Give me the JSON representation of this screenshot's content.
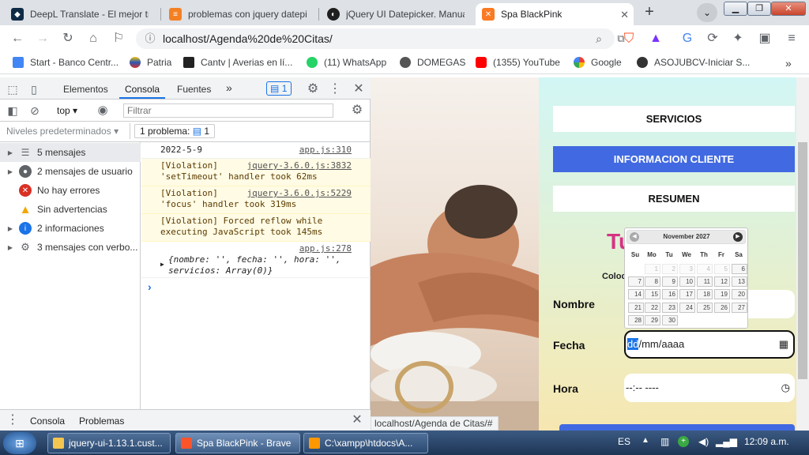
{
  "browser": {
    "tabs": [
      {
        "title": "DeepL Translate - El mejor trad",
        "icon": "deepl-icon"
      },
      {
        "title": "problemas con jquery datepick",
        "icon": "stackoverflow-icon"
      },
      {
        "title": "jQuery UI Datepicker. Manual d",
        "icon": "jquery-icon"
      },
      {
        "title": "Spa BlackPink",
        "icon": "xampp-icon"
      }
    ],
    "url": "localhost/Agenda%20de%20Citas/",
    "bookmarks": [
      "Start - Banco Centr...",
      "Patria",
      "Cantv | Averias en lí...",
      "(11) WhatsApp",
      "DOMEGAS",
      "(1355) YouTube",
      "Google",
      "ASOJUBCV-Iniciar S..."
    ],
    "bookmarks_more": "»"
  },
  "devtools": {
    "tabs": [
      "Elementos",
      "Consola",
      "Fuentes"
    ],
    "more_tabs": "»",
    "issues_badge": "1",
    "context": "top",
    "filter_placeholder": "Filtrar",
    "levels": "Niveles predeterminados",
    "problems": "1 problema:",
    "problems_count": "1",
    "sidebar": [
      {
        "label": "5 mensajes",
        "icon": "list-icon"
      },
      {
        "label": "2 mensajes de usuario",
        "icon": "user-icon"
      },
      {
        "label": "No hay errores",
        "icon": "error-icon"
      },
      {
        "label": "Sin advertencias",
        "icon": "warning-icon"
      },
      {
        "label": "2 informaciones",
        "icon": "info-icon"
      },
      {
        "label": "3 mensajes con verbo...",
        "icon": "gear-icon"
      }
    ],
    "log": [
      {
        "text": "2022-5-9",
        "link": "app.js:310",
        "type": "log"
      },
      {
        "text": "[Violation] 'setTimeout' handler took 62ms",
        "link": "jquery-3.6.0.js:3832",
        "type": "warn"
      },
      {
        "text": "[Violation] 'focus' handler took 319ms",
        "link": "jquery-3.6.0.js:5229",
        "type": "warn"
      },
      {
        "text": "[Violation] Forced reflow while executing JavaScript took 145ms",
        "link": "",
        "type": "warn"
      },
      {
        "text": "{nombre: '', fecha: '', hora: '', servicios: Array(0)}",
        "link": "app.js:278",
        "type": "log"
      }
    ],
    "prompt": "›",
    "drawer_tabs": [
      "Consola",
      "Problemas"
    ]
  },
  "page": {
    "nav": [
      "SERVICIOS",
      "INFORMACION CLIENTE",
      "RESUMEN"
    ],
    "heading_partial": "Tu",
    "subtext_partial": "Coloc",
    "fields": {
      "nombre_label": "Nombre",
      "fecha_label": "Fecha",
      "fecha_value_highlight": "dd",
      "fecha_value_rest": "/mm/aaaa",
      "hora_label": "Hora",
      "hora_value": "--:-- ----"
    },
    "datepicker": {
      "month": "November 2027",
      "weekdays": [
        "Su",
        "Mo",
        "Tu",
        "We",
        "Th",
        "Fr",
        "Sa"
      ],
      "weeks": [
        [
          "",
          "1",
          "2",
          "3",
          "4",
          "5",
          "6"
        ],
        [
          "7",
          "8",
          "9",
          "10",
          "11",
          "12",
          "13"
        ],
        [
          "14",
          "15",
          "16",
          "17",
          "18",
          "19",
          "20"
        ],
        [
          "21",
          "22",
          "23",
          "24",
          "25",
          "26",
          "27"
        ],
        [
          "28",
          "29",
          "30",
          "",
          "",
          "",
          ""
        ]
      ],
      "disabled_days": [
        "1",
        "2",
        "3",
        "4",
        "5"
      ]
    },
    "status_url": "localhost/Agenda de Citas/#"
  },
  "taskbar": {
    "items": [
      "jquery-ui-1.13.1.cust...",
      "Spa BlackPink - Brave",
      "C:\\xampp\\htdocs\\A..."
    ],
    "lang": "ES",
    "clock": "12:09 a.m."
  },
  "colors": {
    "accent": "#4169e1",
    "heading_pink": "#d63384"
  }
}
